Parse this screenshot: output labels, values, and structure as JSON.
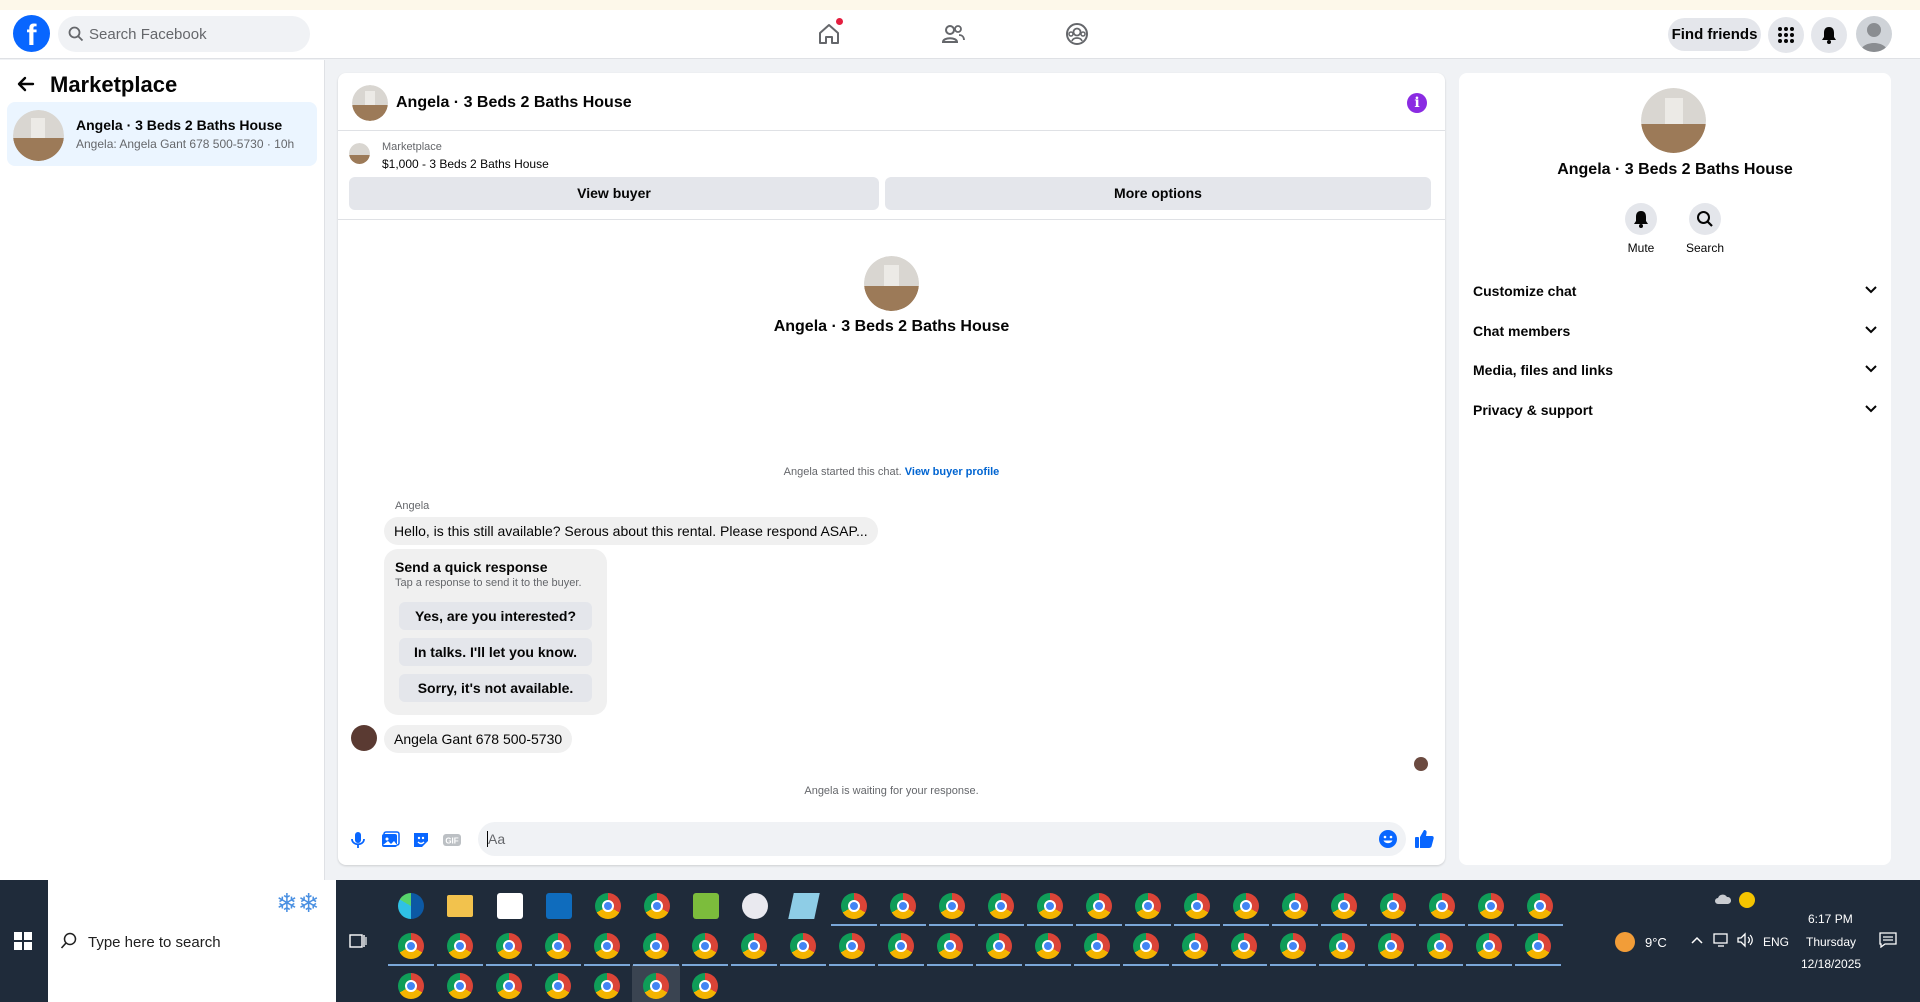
{
  "topbar": {
    "search_placeholder": "Search Facebook",
    "find_friends_label": "Find friends",
    "logo_letter": "f",
    "nav_icons": [
      "home-icon",
      "friends-icon",
      "groups-icon"
    ],
    "right_icons": [
      "menu-grid-icon",
      "notifications-bell-icon",
      "account-avatar-icon"
    ]
  },
  "left": {
    "title": "Marketplace",
    "conversation": {
      "title": "Angela · 3 Beds 2 Baths House",
      "preview": "Angela: Angela Gant 678 500-5730 · 10h"
    }
  },
  "chat": {
    "header_title": "Angela · 3 Beds 2 Baths House",
    "info_icon": "i",
    "marketplace_label": "Marketplace",
    "listing_price_title": "$1,000 - 3 Beds 2 Baths House",
    "view_buyer_label": "View buyer",
    "more_options_label": "More options",
    "center_title": "Angela · 3 Beds 2 Baths House",
    "started_text": "Angela started this chat.",
    "view_buyer_profile_link": "View buyer profile",
    "sender_name": "Angela",
    "message_1": "Hello, is this still available? Serous about this rental. Please respond ASAP...",
    "quick_response": {
      "title": "Send a quick response",
      "subtitle": "Tap a response to send it to the buyer.",
      "options": [
        "Yes, are you interested?",
        "In talks. I'll let you know.",
        "Sorry, it's not available."
      ]
    },
    "message_2": "Angela Gant 678 500-5730",
    "waiting_text": "Angela is waiting for your response.",
    "composer_placeholder": "Aa"
  },
  "details": {
    "title": "Angela · 3 Beds 2 Baths House",
    "mute_label": "Mute",
    "search_label": "Search",
    "sections": [
      "Customize chat",
      "Chat members",
      "Media, files and links",
      "Privacy & support"
    ]
  },
  "taskbar": {
    "search_placeholder": "Type here to search",
    "weather": "9°C",
    "language": "ENG",
    "time": "6:17 PM",
    "day": "Thursday",
    "date": "12/18/2025"
  },
  "colors": {
    "brand_blue": "#0866ff",
    "link_blue": "#0064d1",
    "info_purple": "#8a2be2",
    "taskbar_bg": "#1f2b3a"
  }
}
